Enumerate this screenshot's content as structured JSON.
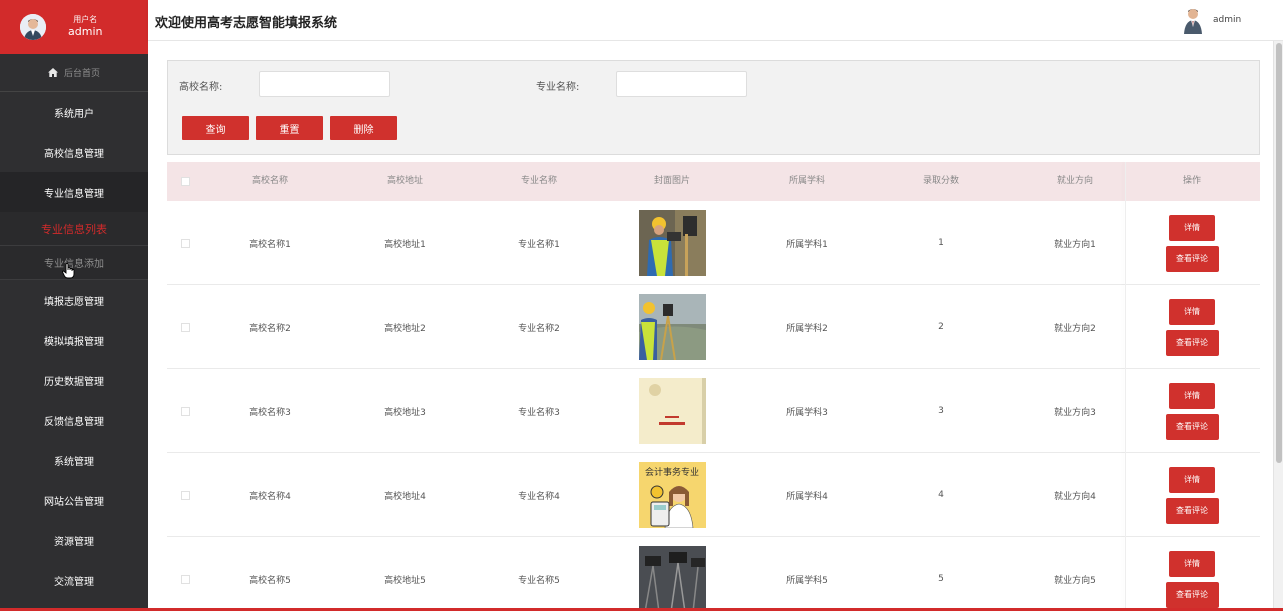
{
  "sidebar": {
    "user_label": "用户名",
    "user_name": "admin",
    "home": "后台首页",
    "items": [
      {
        "label": "系统用户"
      },
      {
        "label": "高校信息管理"
      },
      {
        "label": "专业信息管理"
      }
    ],
    "sub_items": [
      {
        "label": "专业信息列表",
        "state": "active"
      },
      {
        "label": "专业信息添加",
        "state": "hover"
      }
    ],
    "items_after": [
      {
        "label": "填报志愿管理"
      },
      {
        "label": "模拟填报管理"
      },
      {
        "label": "历史数据管理"
      },
      {
        "label": "反馈信息管理"
      },
      {
        "label": "系统管理"
      },
      {
        "label": "网站公告管理"
      },
      {
        "label": "资源管理"
      },
      {
        "label": "交流管理"
      }
    ]
  },
  "header": {
    "title": "欢迎使用高考志愿智能填报系统",
    "user_name": "admin"
  },
  "search": {
    "school_label": "高校名称:",
    "school_value": "",
    "major_label": "专业名称:",
    "major_value": "",
    "query_button": "查询",
    "reset_button": "重置",
    "delete_button": "删除"
  },
  "table": {
    "columns": [
      "高校名称",
      "高校地址",
      "专业名称",
      "封面图片",
      "所属学科",
      "录取分数",
      "就业方向",
      "操作"
    ],
    "rows": [
      {
        "school": "高校名称1",
        "address": "高校地址1",
        "major": "专业名称1",
        "image": "surveyor-photo",
        "subject": "所属学科1",
        "score": "1",
        "career": "就业方向1"
      },
      {
        "school": "高校名称2",
        "address": "高校地址2",
        "major": "专业名称2",
        "image": "surveyor-field-photo",
        "subject": "所属学科2",
        "score": "2",
        "career": "就业方向2"
      },
      {
        "school": "高校名称3",
        "address": "高校地址3",
        "major": "专业名称3",
        "image": "book-cover-photo",
        "subject": "所属学科3",
        "score": "3",
        "career": "就业方向3"
      },
      {
        "school": "高校名称4",
        "address": "高校地址4",
        "major": "专业名称4",
        "image": "accounting-illustration",
        "image_text": "会计事务专业",
        "subject": "所属学科4",
        "score": "4",
        "career": "就业方向4"
      },
      {
        "school": "高校名称5",
        "address": "高校地址5",
        "major": "专业名称5",
        "image": "camera-tripods-photo",
        "subject": "所属学科5",
        "score": "5",
        "career": "就业方向5"
      }
    ],
    "detail_button": "详情",
    "review_button": "查看评论"
  },
  "colors": {
    "accent": "#d22b2b",
    "sidebar_bg": "#2f2f31",
    "table_header_bg": "#f4e4e6"
  }
}
